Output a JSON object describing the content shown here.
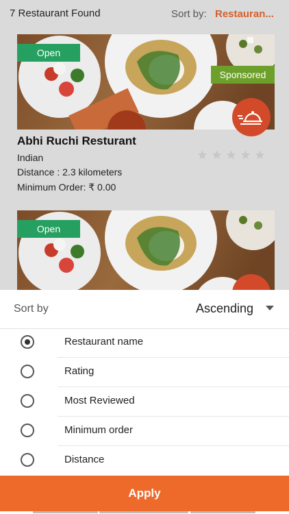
{
  "header": {
    "found_text": "7 Restaurant Found",
    "sort_label": "Sort by:",
    "sort_value": "Restauran..."
  },
  "cards": [
    {
      "open_badge": "Open",
      "sponsored_badge": "Sponsored",
      "name": "Abhi Ruchi Resturant",
      "cuisine": "Indian",
      "distance": "Distance : 2.3 kilometers",
      "min_order": "Minimum Order: ₹ 0.00",
      "rating_stars": 0
    },
    {
      "open_badge": "Open"
    }
  ],
  "sort_sheet": {
    "label": "Sort by",
    "order": "Ascending",
    "options": [
      {
        "label": "Restaurant name",
        "selected": true
      },
      {
        "label": "Rating",
        "selected": false
      },
      {
        "label": "Most Reviewed",
        "selected": false
      },
      {
        "label": "Minimum order",
        "selected": false
      },
      {
        "label": "Distance",
        "selected": false
      }
    ],
    "apply_label": "Apply"
  },
  "colors": {
    "accent": "#ee6a2a",
    "open_badge": "#26a060",
    "sponsored_badge": "#6da02a",
    "delivery_icon_bg": "#d24a2a"
  },
  "icons": [
    "delivery-cloche-icon",
    "star-icon",
    "caret-down-icon",
    "radio-button"
  ]
}
